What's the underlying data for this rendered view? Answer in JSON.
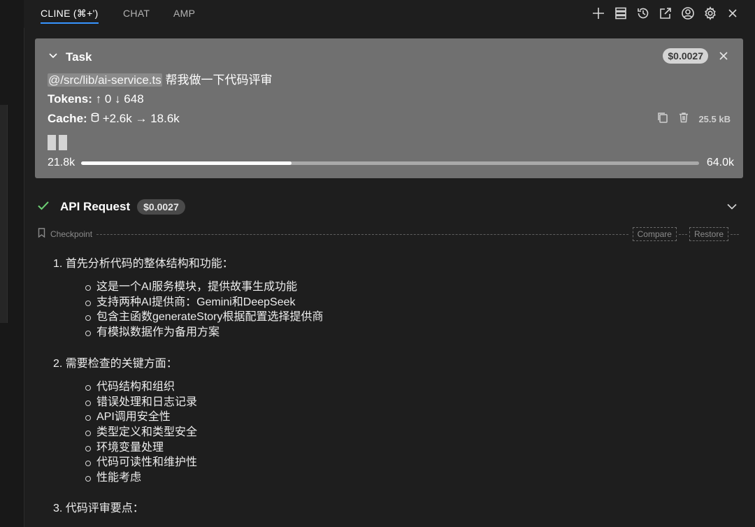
{
  "tabs": [
    {
      "label": "CLINE (⌘+')",
      "active": true
    },
    {
      "label": "CHAT",
      "active": false
    },
    {
      "label": "AMP",
      "active": false
    }
  ],
  "toolbar_icons": [
    "plus-icon",
    "server-icon",
    "history-icon",
    "external-link-icon",
    "account-icon",
    "gear-icon",
    "close-icon"
  ],
  "task": {
    "title": "Task",
    "cost": "$0.0027",
    "mention": "@/src/lib/ai-service.ts",
    "prompt": " 帮我做一下代码评审",
    "tokens_label": "Tokens:",
    "tokens_value": "↑ 0 ↓ 648",
    "cache_label": "Cache:",
    "cache_value": "+2.6k → 18.6k",
    "size": "25.5 kB",
    "context_used": "21.8k",
    "context_max": "64.0k",
    "context_fraction": 0.3406
  },
  "api_request": {
    "title": "API Request",
    "cost": "$0.0027",
    "status_color": "#6ccf74"
  },
  "checkpoint": {
    "label": "Checkpoint",
    "compare": "Compare",
    "restore": "Restore"
  },
  "content": {
    "sections": [
      {
        "heading": "1. 首先分析代码的整体结构和功能：",
        "items": [
          "这是一个AI服务模块，提供故事生成功能",
          "支持两种AI提供商：Gemini和DeepSeek",
          "包含主函数generateStory根据配置选择提供商",
          "有模拟数据作为备用方案"
        ]
      },
      {
        "heading": "2. 需要检查的关键方面：",
        "items": [
          "代码结构和组织",
          "错误处理和日志记录",
          "API调用安全性",
          "类型定义和类型安全",
          "环境变量处理",
          "代码可读性和维护性",
          "性能考虑"
        ]
      },
      {
        "heading": "3. 代码评审要点：",
        "items": []
      }
    ]
  }
}
